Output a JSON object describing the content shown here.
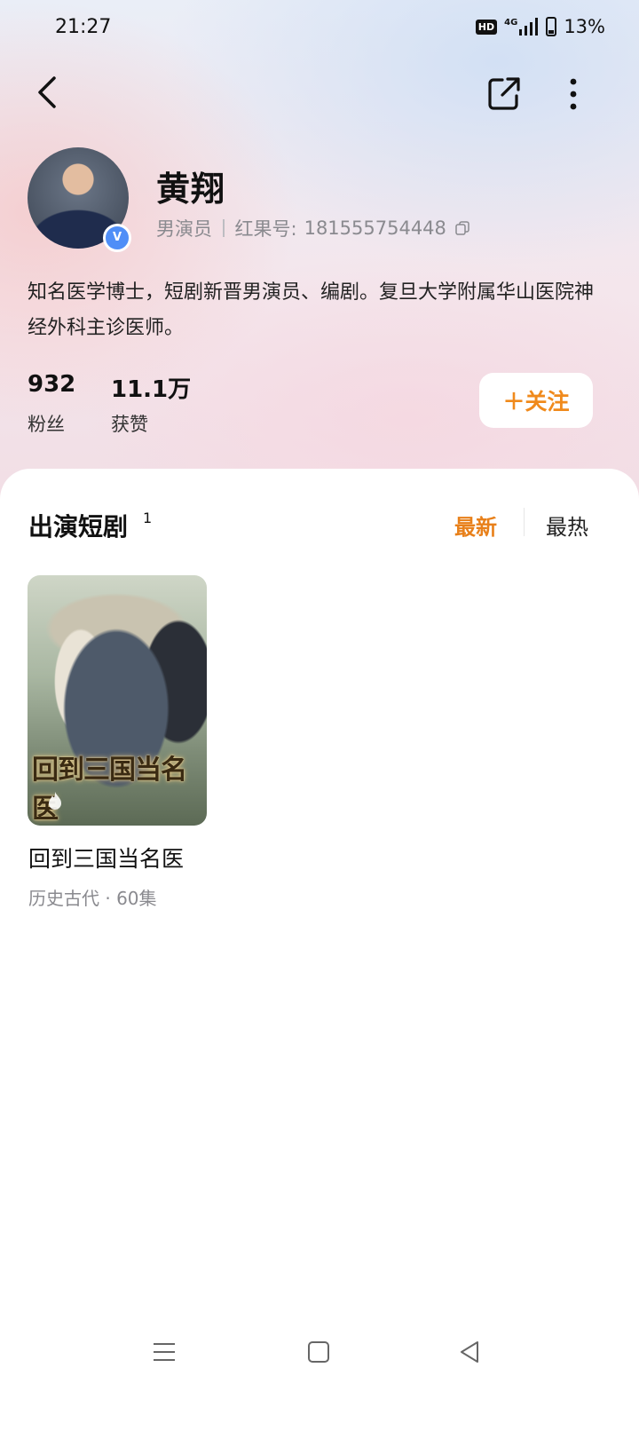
{
  "status_bar": {
    "time": "21:27",
    "hd_label": "HD",
    "network_label": "4G",
    "battery_percent": "13%"
  },
  "profile": {
    "name": "黄翔",
    "role": "男演员",
    "id_label": "红果号:",
    "id_value": "181555754448",
    "bio": "知名医学博士，短剧新晋男演员、编剧。复旦大学附属华山医院神经外科主诊医师。",
    "verified": "V",
    "stats": {
      "fans_count": "932",
      "fans_label": "粉丝",
      "likes_count": "11.1万",
      "likes_label": "获赞"
    },
    "follow_label": "＋关注"
  },
  "section": {
    "title": "出演短剧",
    "count": "1",
    "sort_options": [
      "最新",
      "最热"
    ]
  },
  "dramas": [
    {
      "poster_text": "回到三国当名医",
      "title": "回到三国当名医",
      "meta": "历史古代 · 60集"
    }
  ],
  "colors": {
    "accent": "#e8801a",
    "verify": "#4f8ef7"
  },
  "icons": [
    "back-arrow-icon",
    "share-icon",
    "more-vertical-icon",
    "copy-icon",
    "fire-icon",
    "menu-icon",
    "home-icon",
    "back-triangle-icon"
  ]
}
